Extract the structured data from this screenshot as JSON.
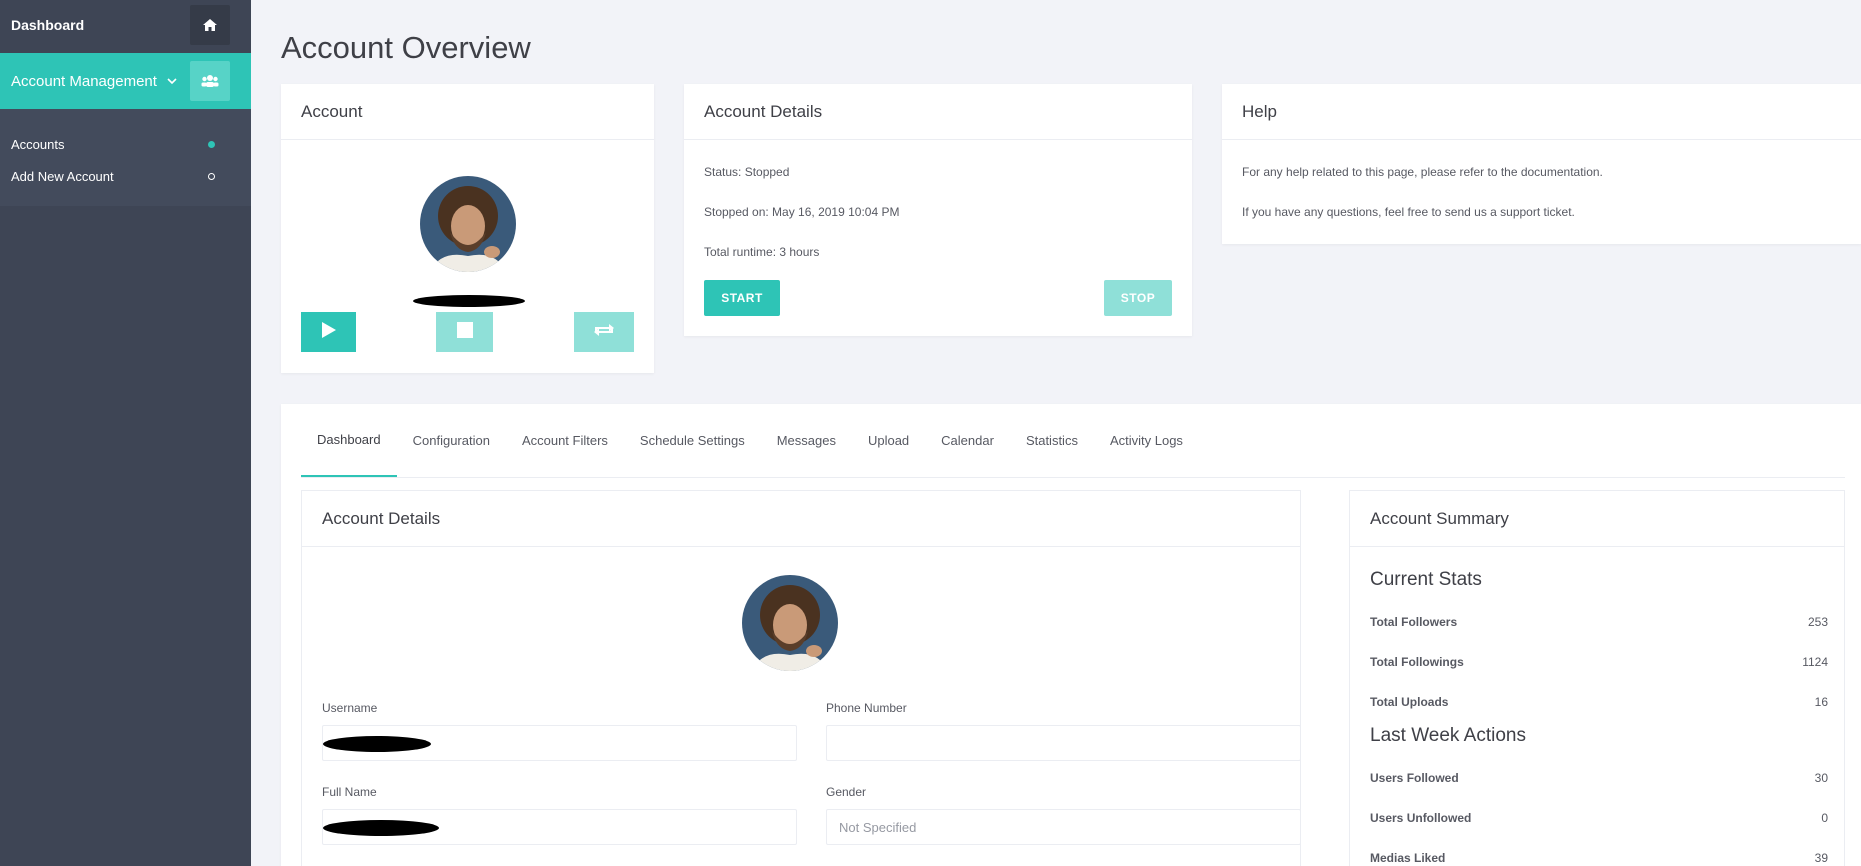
{
  "sidebar": {
    "dashboard_label": "Dashboard",
    "account_mgmt_label": "Account Management",
    "submenu": [
      {
        "label": "Accounts"
      },
      {
        "label": "Add New Account"
      }
    ]
  },
  "page_title": "Account Overview",
  "account_card": {
    "title": "Account"
  },
  "account_details_card": {
    "title": "Account Details",
    "status": "Status: Stopped",
    "stopped_on": "Stopped on: May 16, 2019 10:04 PM",
    "runtime": "Total runtime: 3 hours",
    "start_label": "START",
    "stop_label": "STOP"
  },
  "help_card": {
    "title": "Help",
    "line1": "For any help related to this page, please refer to the documentation.",
    "line2": "If you have any questions, feel free to send us a support ticket."
  },
  "tabs": [
    {
      "label": "Dashboard"
    },
    {
      "label": "Configuration"
    },
    {
      "label": "Account Filters"
    },
    {
      "label": "Schedule Settings"
    },
    {
      "label": "Messages"
    },
    {
      "label": "Upload"
    },
    {
      "label": "Calendar"
    },
    {
      "label": "Statistics"
    },
    {
      "label": "Activity Logs"
    }
  ],
  "details_panel": {
    "title": "Account Details",
    "username_label": "Username",
    "phone_label": "Phone Number",
    "phone_value": "",
    "fullname_label": "Full Name",
    "gender_label": "Gender",
    "gender_value": "Not Specified"
  },
  "summary_panel": {
    "title": "Account Summary",
    "current_heading": "Current Stats",
    "current": [
      {
        "label": "Total Followers",
        "value": "253"
      },
      {
        "label": "Total Followings",
        "value": "1124"
      },
      {
        "label": "Total Uploads",
        "value": "16"
      }
    ],
    "week_heading": "Last Week Actions",
    "week": [
      {
        "label": "Users Followed",
        "value": "30"
      },
      {
        "label": "Users Unfollowed",
        "value": "0"
      },
      {
        "label": "Medias Liked",
        "value": "39"
      }
    ]
  },
  "colors": {
    "accent": "#2ec4b6",
    "accent_light": "#8fe0d8",
    "sidebar": "#3e4555"
  }
}
